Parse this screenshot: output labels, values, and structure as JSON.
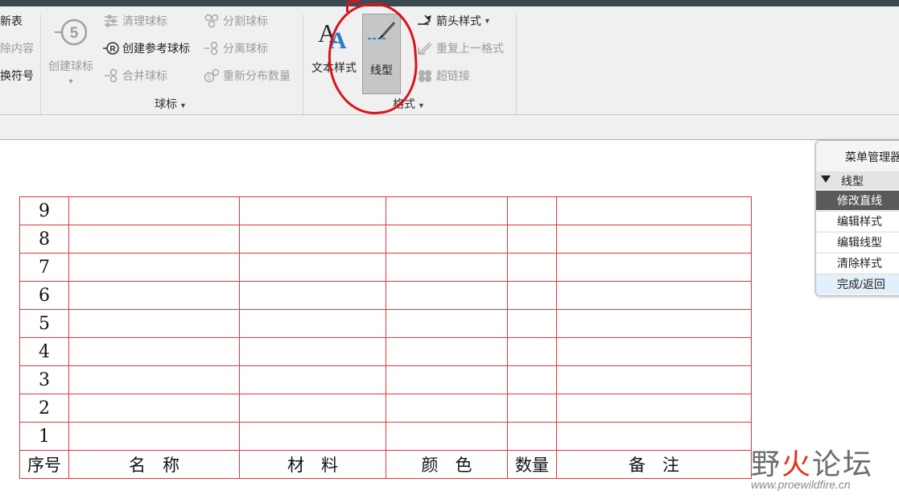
{
  "ribbon": {
    "left_partial": {
      "row1": "新表",
      "row2": "除内容",
      "row3": "换符号"
    },
    "balloon_group": {
      "create_balloon": "创建球标",
      "cleanup_balloons": "清理球标",
      "create_ref_balloon": "创建参考球标",
      "merge_balloons": "合并球标",
      "split_balloons": "分割球标",
      "detach_balloons": "分离球标",
      "redistribute_qty": "重新分布数量",
      "group_label": "球标"
    },
    "format_group": {
      "text_style": "文本样式",
      "line_style": "线型",
      "arrow_style": "箭头样式",
      "repeat_format": "重复上一格式",
      "hyperlink": "超链接",
      "group_label": "格式"
    }
  },
  "bom_table": {
    "rows": [
      "9",
      "8",
      "7",
      "6",
      "5",
      "4",
      "3",
      "2",
      "1"
    ],
    "headers": [
      "序号",
      "名　称",
      "材　料",
      "颜　色",
      "数量",
      "备　注"
    ]
  },
  "menu_manager": {
    "title": "菜单管理器",
    "submenu": "线型",
    "items": [
      "修改直线",
      "编辑样式",
      "编辑线型",
      "清除样式",
      "完成/返回"
    ]
  },
  "watermark": {
    "ye": "野",
    "huo": "火",
    "luntan": "论坛",
    "url": "www.proewildfire.cn"
  },
  "colors": {
    "table_border": "#e8343c",
    "annotation_circle": "#d9141c",
    "menu_active": "#5a5a5a",
    "menu_done": "#e2f0fb"
  }
}
